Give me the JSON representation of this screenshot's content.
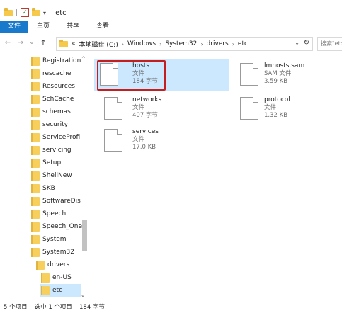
{
  "titlebar": {
    "qat_sep": "|",
    "qat_arrow": "▾",
    "sep2": "|",
    "title": "etc"
  },
  "ribbon": {
    "tabs": [
      "文件",
      "主页",
      "共享",
      "查看"
    ]
  },
  "address": {
    "back": "←",
    "forward": "→",
    "recent": "⌄",
    "up": "↑",
    "overflow": "«",
    "crumbs": [
      "本地磁盘 (C:)",
      "Windows",
      "System32",
      "drivers",
      "etc"
    ],
    "sep": "›",
    "dropdown": "⌄",
    "refresh": "↻",
    "search_placeholder": "搜索\"etc\""
  },
  "navpane": {
    "items": [
      "Registration",
      "rescache",
      "Resources",
      "SchCache",
      "schemas",
      "security",
      "ServiceProfil",
      "servicing",
      "Setup",
      "ShellNew",
      "SKB",
      "SoftwareDis",
      "Speech",
      "Speech_One",
      "System",
      "System32",
      "drivers",
      "en-US",
      "etc"
    ],
    "selected": "etc",
    "scroll_up": "^",
    "scroll_down": "v"
  },
  "files": [
    {
      "name": "hosts",
      "type": "文件",
      "size": "184 字节",
      "selected": true
    },
    {
      "name": "lmhosts.sam",
      "type": "SAM 文件",
      "size": "3.59 KB",
      "selected": false
    },
    {
      "name": "networks",
      "type": "文件",
      "size": "407 字节",
      "selected": false
    },
    {
      "name": "protocol",
      "type": "文件",
      "size": "1.32 KB",
      "selected": false
    },
    {
      "name": "services",
      "type": "文件",
      "size": "17.0 KB",
      "selected": false
    }
  ],
  "statusbar": {
    "count": "5 个项目",
    "selected": "选中 1 个项目",
    "size": "184 字节"
  },
  "colors": {
    "accent": "#1979ca",
    "selection": "#cce8ff",
    "highlight_box": "#c41e1e",
    "folder": "#f6cf5c"
  }
}
